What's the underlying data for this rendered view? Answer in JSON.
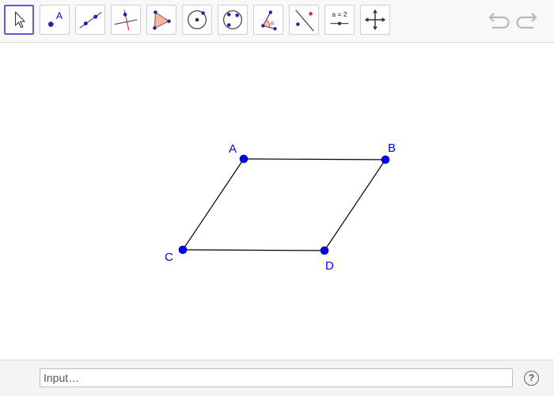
{
  "toolbar": {
    "tools": [
      {
        "id": "move",
        "icon": "arrow-cursor-icon",
        "selected": true
      },
      {
        "id": "point",
        "icon": "new-point-icon",
        "label": "A"
      },
      {
        "id": "line",
        "icon": "line-through-two-points-icon"
      },
      {
        "id": "perpendicular",
        "icon": "perpendicular-line-icon"
      },
      {
        "id": "polygon",
        "icon": "polygon-icon"
      },
      {
        "id": "circle",
        "icon": "circle-center-point-icon"
      },
      {
        "id": "circle-three-points",
        "icon": "circle-through-three-points-icon"
      },
      {
        "id": "angle",
        "icon": "angle-icon",
        "label": "α"
      },
      {
        "id": "reflect",
        "icon": "reflect-about-line-icon"
      },
      {
        "id": "slider",
        "icon": "slider-icon",
        "label": "a = 2"
      },
      {
        "id": "move-view",
        "icon": "move-graphics-view-icon"
      }
    ],
    "undo_icon": "undo-icon",
    "redo_icon": "redo-icon"
  },
  "construction": {
    "point_color": "#0000ff",
    "label_color": "#0000ff",
    "segment_color": "#000000",
    "points": [
      {
        "label": "A"
      },
      {
        "label": "B"
      },
      {
        "label": "C"
      },
      {
        "label": "D"
      }
    ],
    "segments": [
      [
        "A",
        "B"
      ],
      [
        "B",
        "D"
      ],
      [
        "D",
        "C"
      ],
      [
        "C",
        "A"
      ]
    ]
  },
  "input_bar": {
    "placeholder": "Input…",
    "help_label": "?"
  }
}
